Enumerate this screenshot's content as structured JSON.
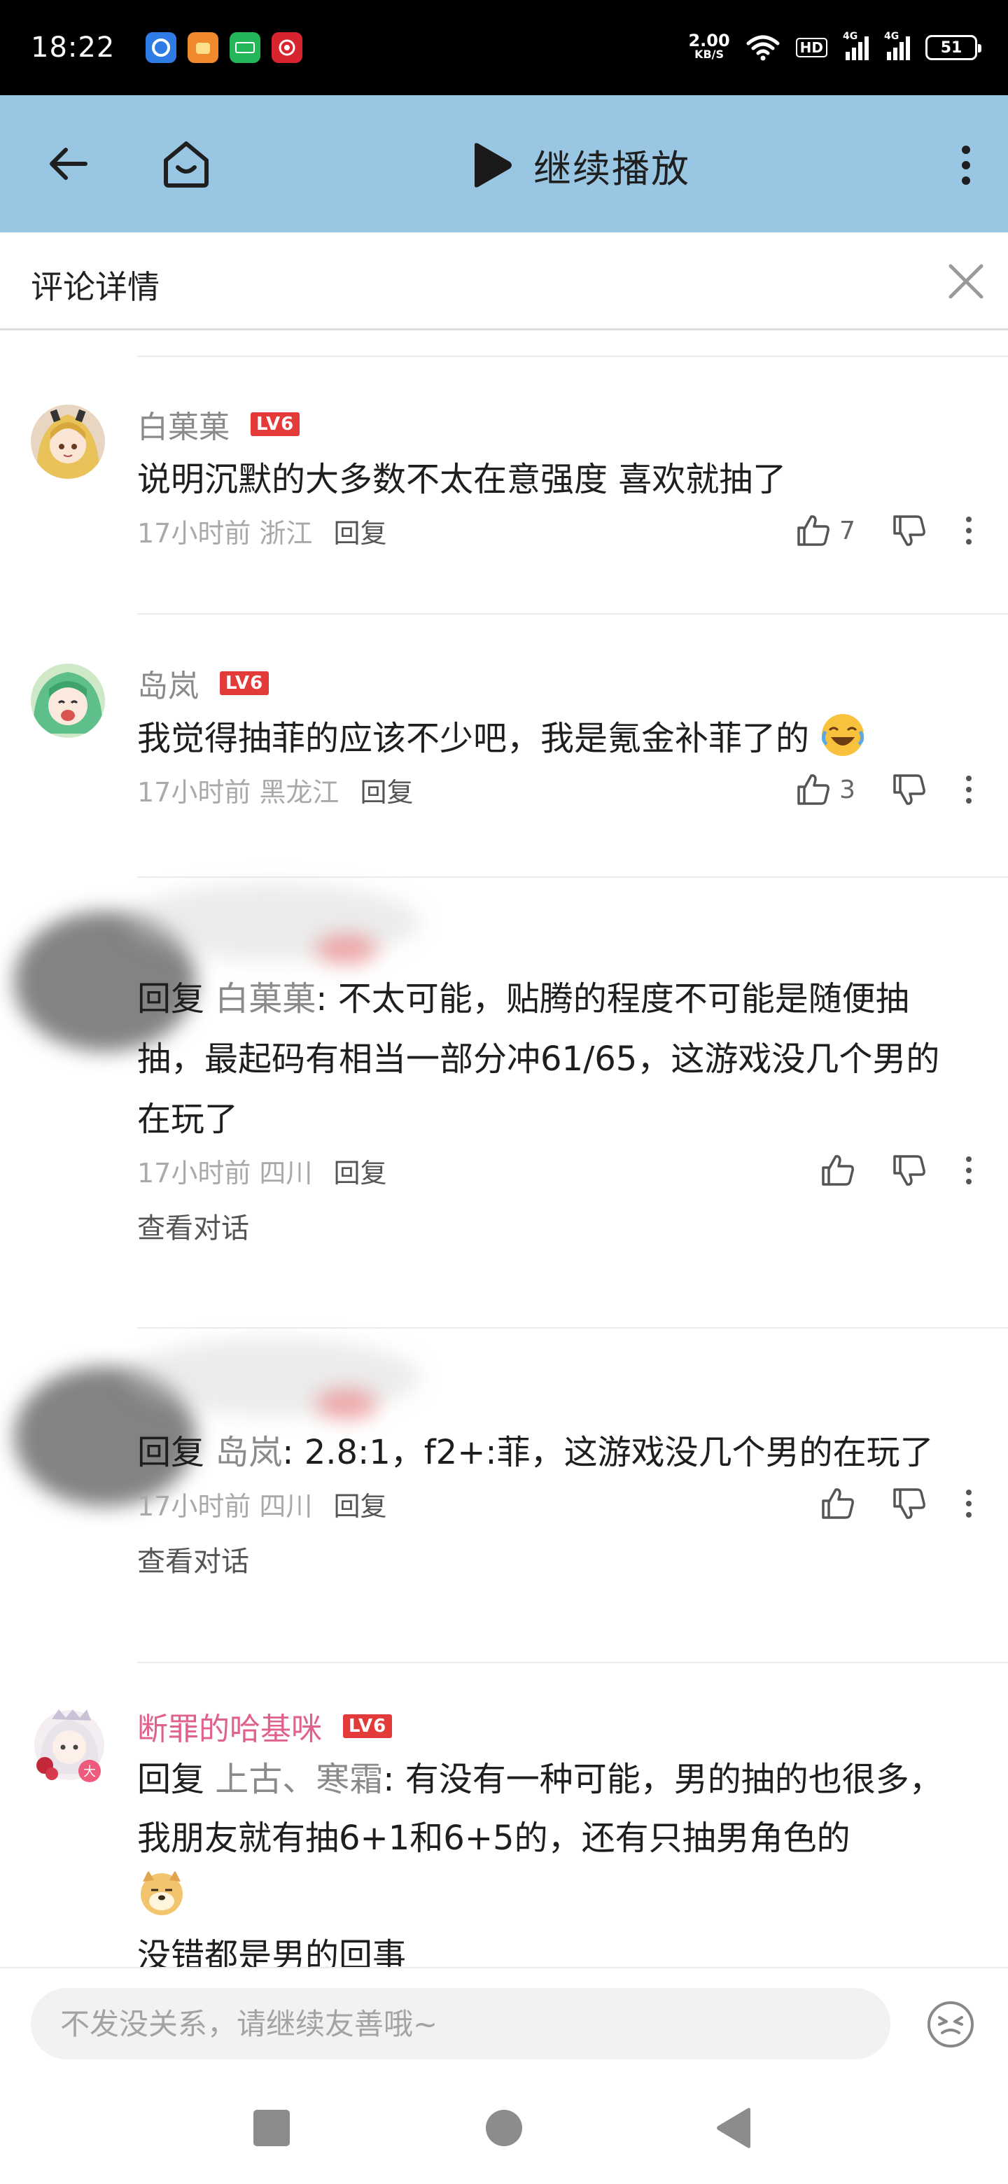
{
  "status_bar": {
    "time": "18:22",
    "net_speed_value": "2.00",
    "net_speed_unit": "KB/S",
    "hd_label": "HD",
    "signal_label": "4G",
    "battery": "51",
    "app_icons": [
      "app-icon-1",
      "app-icon-2",
      "iqiyi-icon",
      "app-icon-4"
    ]
  },
  "header": {
    "play_label": "继续播放",
    "background": "#99c6e2"
  },
  "detail": {
    "title": "评论详情"
  },
  "comments": [
    {
      "name": "白菓菓",
      "level": "LV6",
      "text": "说明沉默的大多数不太在意强度 喜欢就抽了",
      "time_location": "17小时前 浙江",
      "reply": "回复",
      "likes": "7"
    },
    {
      "name": "岛岚",
      "level": "LV6",
      "text": "我觉得抽菲的应该不少吧，我是氪金补菲了的",
      "emoji": "laugh-cry-emoji",
      "time_location": "17小时前 黑龙江",
      "reply": "回复",
      "likes": "3"
    },
    {
      "reply_prefix": "回复",
      "reply_to": "白菓菓",
      "text": ": 不太可能，贴腾的程度不可能是随便抽抽，最起码有相当一部分冲61/65，这游戏没几个男的在玩了",
      "time_location": "17小时前 四川",
      "reply": "回复",
      "view_conversation": "查看对话"
    },
    {
      "reply_prefix": "回复",
      "reply_to": "岛岚",
      "text": ": 2.8:1，f2+:菲，这游戏没几个男的在玩了",
      "time_location": "17小时前 四川",
      "reply": "回复",
      "view_conversation": "查看对话"
    },
    {
      "name": "断罪的哈基咪",
      "level": "LV6",
      "reply_prefix": "回复",
      "reply_to": "上古、寒霜",
      "text": ": 有没有一种可能，男的抽的也很多，我朋友就有抽6+1和6+5的，还有只抽男角色的",
      "emoji": "doge-emoji",
      "text_cut": "没错都是男的回事"
    }
  ],
  "input": {
    "placeholder": "不发没关系，请继续友善哦~"
  },
  "colors": {
    "header_bg": "#99c6e2",
    "level_badge": "#e33a3a",
    "pink_name": "#e0608e"
  }
}
